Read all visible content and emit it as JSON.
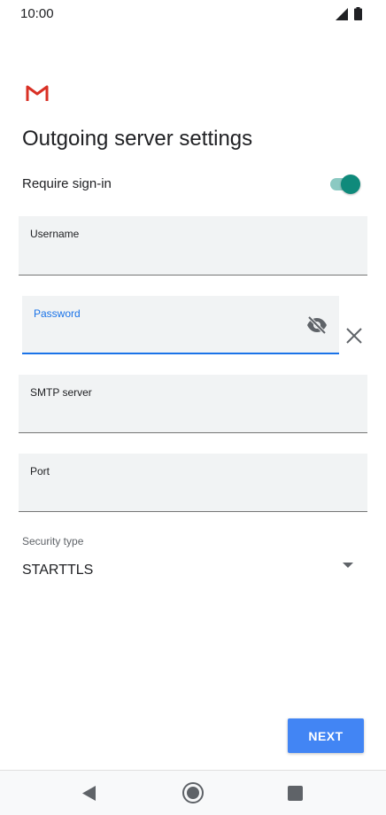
{
  "status_bar": {
    "time": "10:00",
    "icons": [
      "signal-icon",
      "battery-icon"
    ]
  },
  "app": {
    "logo_icon": "gmail-logo-icon"
  },
  "page": {
    "title": "Outgoing server settings"
  },
  "require_signin": {
    "label": "Require sign-in",
    "enabled": true
  },
  "fields": {
    "username": {
      "label": "Username",
      "value": ""
    },
    "password": {
      "label": "Password",
      "value": "",
      "visibility_icon": "visibility-off-icon",
      "clear_icon": "close-icon"
    },
    "smtp_server": {
      "label": "SMTP server",
      "value": ""
    },
    "port": {
      "label": "Port",
      "value": ""
    }
  },
  "security_type": {
    "label": "Security type",
    "selected": "STARTTLS",
    "icon": "arrow-drop-down-icon"
  },
  "actions": {
    "next_label": "NEXT"
  },
  "nav_bar": {
    "icons": [
      "back-icon",
      "home-icon",
      "recents-icon"
    ]
  },
  "colors": {
    "accent": "#1a73e8",
    "button": "#4285f4",
    "toggle_on": "#0f8a7b",
    "toggle_track": "#8bc9c2",
    "field_bg": "#f1f3f4"
  }
}
